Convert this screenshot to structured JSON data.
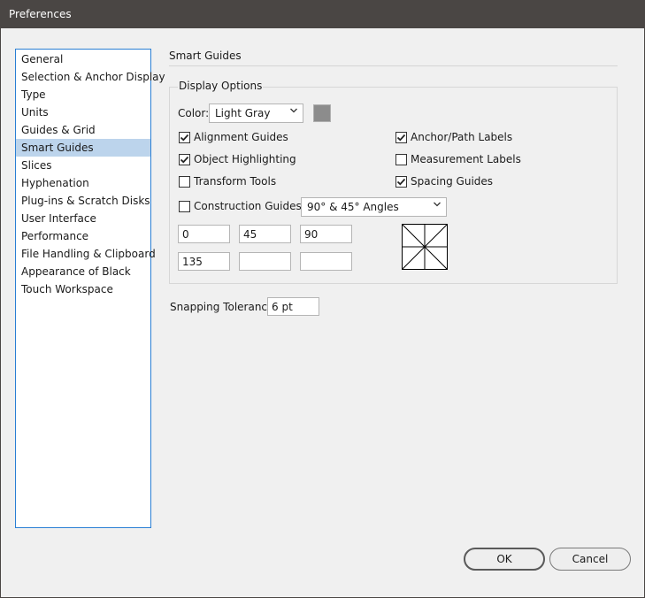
{
  "window": {
    "title": "Preferences"
  },
  "sidebar": {
    "items": [
      {
        "label": "General",
        "selected": false
      },
      {
        "label": "Selection & Anchor Display",
        "selected": false
      },
      {
        "label": "Type",
        "selected": false
      },
      {
        "label": "Units",
        "selected": false
      },
      {
        "label": "Guides & Grid",
        "selected": false
      },
      {
        "label": "Smart Guides",
        "selected": true
      },
      {
        "label": "Slices",
        "selected": false
      },
      {
        "label": "Hyphenation",
        "selected": false
      },
      {
        "label": "Plug-ins & Scratch Disks",
        "selected": false
      },
      {
        "label": "User Interface",
        "selected": false
      },
      {
        "label": "Performance",
        "selected": false
      },
      {
        "label": "File Handling & Clipboard",
        "selected": false
      },
      {
        "label": "Appearance of Black",
        "selected": false
      },
      {
        "label": "Touch Workspace",
        "selected": false
      }
    ]
  },
  "panel": {
    "title": "Smart Guides",
    "display_options": {
      "label": "Display Options",
      "color_label": "Color:",
      "color_value": "Light Gray",
      "swatch_color": "#8c8c8c",
      "checkboxes": {
        "alignment_guides": {
          "label": "Alignment Guides",
          "checked": true
        },
        "anchor_path_labels": {
          "label": "Anchor/Path Labels",
          "checked": true
        },
        "object_highlighting": {
          "label": "Object Highlighting",
          "checked": true
        },
        "measurement_labels": {
          "label": "Measurement Labels",
          "checked": false
        },
        "transform_tools": {
          "label": "Transform Tools",
          "checked": false
        },
        "spacing_guides": {
          "label": "Spacing Guides",
          "checked": true
        },
        "construction_guides": {
          "label": "Construction Guides:",
          "checked": false
        }
      },
      "construction_angles_value": "90° & 45° Angles",
      "angles": [
        "0",
        "45",
        "90",
        "135",
        "",
        ""
      ]
    },
    "snapping": {
      "label": "Snapping Tolerance:",
      "value": "6 pt"
    }
  },
  "buttons": {
    "ok": "OK",
    "cancel": "Cancel"
  }
}
